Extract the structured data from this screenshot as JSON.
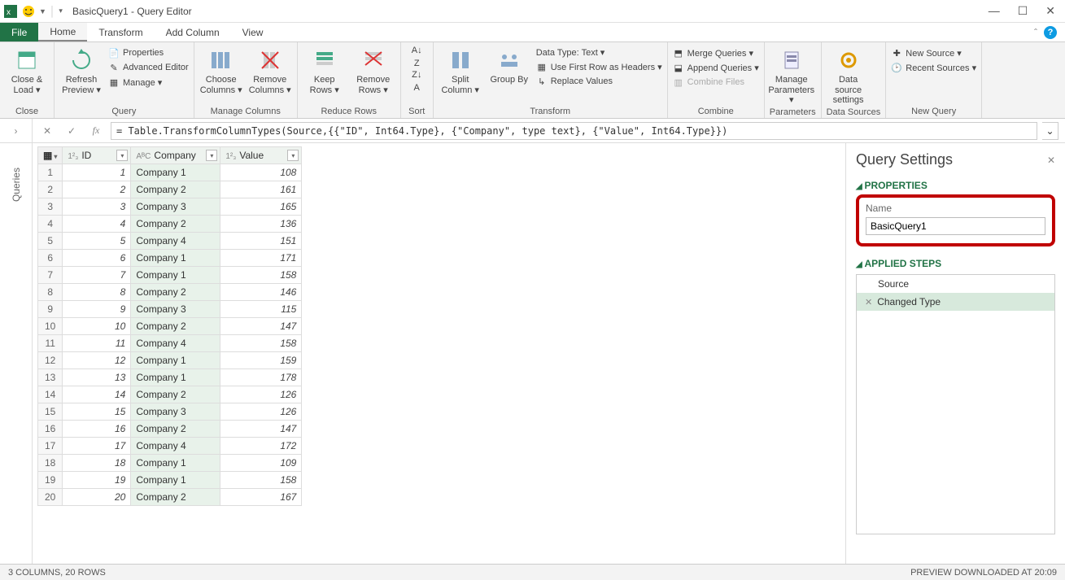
{
  "window": {
    "title": "BasicQuery1 - Query Editor"
  },
  "tabs": {
    "file": "File",
    "home": "Home",
    "transform": "Transform",
    "add_column": "Add Column",
    "view": "View"
  },
  "ribbon": {
    "close": {
      "close_load": "Close &\nLoad ▾",
      "group": "Close"
    },
    "query": {
      "refresh": "Refresh\nPreview ▾",
      "properties": "Properties",
      "advanced_editor": "Advanced Editor",
      "manage": "Manage ▾",
      "group": "Query"
    },
    "manage_cols": {
      "choose": "Choose\nColumns ▾",
      "remove": "Remove\nColumns ▾",
      "group": "Manage Columns"
    },
    "reduce_rows": {
      "keep": "Keep\nRows ▾",
      "remove": "Remove\nRows ▾",
      "group": "Reduce Rows"
    },
    "sort": {
      "group": "Sort"
    },
    "transform": {
      "split": "Split\nColumn ▾",
      "group_by": "Group\nBy",
      "data_type": "Data Type: Text ▾",
      "first_row": "Use First Row as Headers ▾",
      "replace": "Replace Values",
      "group": "Transform"
    },
    "combine": {
      "merge": "Merge Queries ▾",
      "append": "Append Queries ▾",
      "combine_files": "Combine Files",
      "group": "Combine"
    },
    "parameters": {
      "manage": "Manage\nParameters ▾",
      "group": "Parameters"
    },
    "data_sources": {
      "settings": "Data source\nsettings",
      "group": "Data Sources"
    },
    "new_query": {
      "new_source": "New Source ▾",
      "recent": "Recent Sources ▾",
      "group": "New Query"
    }
  },
  "formula_bar": {
    "text": "= Table.TransformColumnTypes(Source,{{\"ID\", Int64.Type}, {\"Company\", type text}, {\"Value\", Int64.Type}})"
  },
  "queries_panel_label": "Queries",
  "columns": [
    {
      "name": "ID",
      "type": "1²₃"
    },
    {
      "name": "Company",
      "type": "AᴮC"
    },
    {
      "name": "Value",
      "type": "1²₃"
    }
  ],
  "rows": [
    {
      "n": 1,
      "id": 1,
      "company": "Company 1",
      "value": 108
    },
    {
      "n": 2,
      "id": 2,
      "company": "Company 2",
      "value": 161
    },
    {
      "n": 3,
      "id": 3,
      "company": "Company 3",
      "value": 165
    },
    {
      "n": 4,
      "id": 4,
      "company": "Company 2",
      "value": 136
    },
    {
      "n": 5,
      "id": 5,
      "company": "Company 4",
      "value": 151
    },
    {
      "n": 6,
      "id": 6,
      "company": "Company 1",
      "value": 171
    },
    {
      "n": 7,
      "id": 7,
      "company": "Company 1",
      "value": 158
    },
    {
      "n": 8,
      "id": 8,
      "company": "Company 2",
      "value": 146
    },
    {
      "n": 9,
      "id": 9,
      "company": "Company 3",
      "value": 115
    },
    {
      "n": 10,
      "id": 10,
      "company": "Company 2",
      "value": 147
    },
    {
      "n": 11,
      "id": 11,
      "company": "Company 4",
      "value": 158
    },
    {
      "n": 12,
      "id": 12,
      "company": "Company 1",
      "value": 159
    },
    {
      "n": 13,
      "id": 13,
      "company": "Company 1",
      "value": 178
    },
    {
      "n": 14,
      "id": 14,
      "company": "Company 2",
      "value": 126
    },
    {
      "n": 15,
      "id": 15,
      "company": "Company 3",
      "value": 126
    },
    {
      "n": 16,
      "id": 16,
      "company": "Company 2",
      "value": 147
    },
    {
      "n": 17,
      "id": 17,
      "company": "Company 4",
      "value": 172
    },
    {
      "n": 18,
      "id": 18,
      "company": "Company 1",
      "value": 109
    },
    {
      "n": 19,
      "id": 19,
      "company": "Company 1",
      "value": 158
    },
    {
      "n": 20,
      "id": 20,
      "company": "Company 2",
      "value": 167
    }
  ],
  "settings": {
    "title": "Query Settings",
    "properties_label": "PROPERTIES",
    "name_label": "Name",
    "name_value": "BasicQuery1",
    "applied_steps_label": "APPLIED STEPS",
    "steps": [
      {
        "label": "Source",
        "selected": false
      },
      {
        "label": "Changed Type",
        "selected": true
      }
    ]
  },
  "status": {
    "left": "3 COLUMNS, 20 ROWS",
    "right": "PREVIEW DOWNLOADED AT 20:09"
  }
}
